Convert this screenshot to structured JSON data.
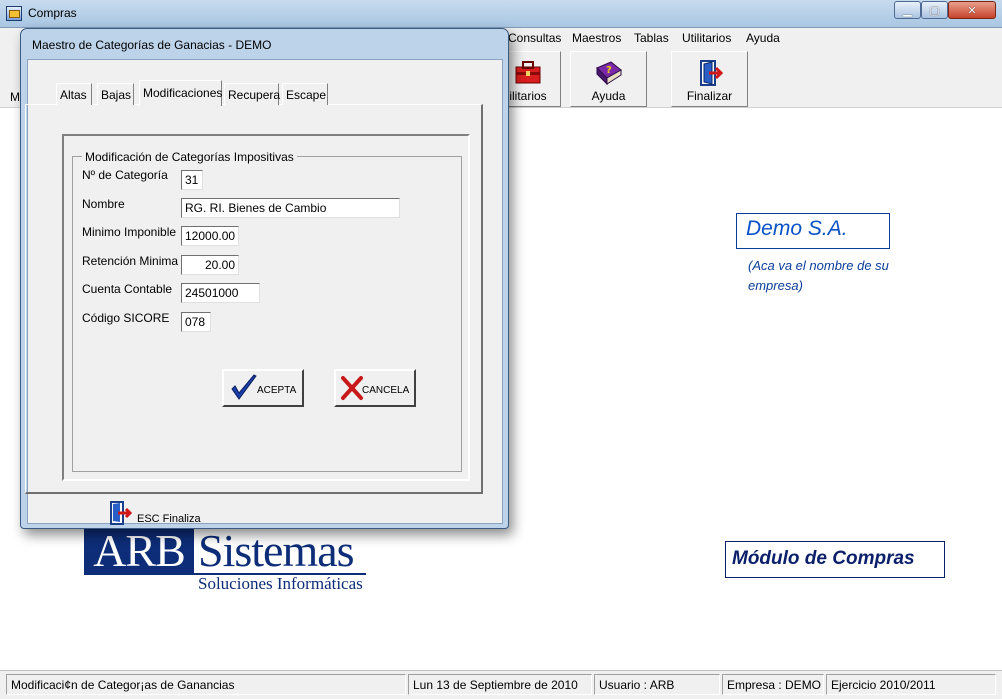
{
  "window": {
    "title": "Compras"
  },
  "menu": {
    "items": [
      "Consultas",
      "Maestros",
      "Tablas",
      "Utilitarios",
      "Ayuda"
    ]
  },
  "toolbar": {
    "left_fragment": "M",
    "buttons": [
      {
        "label": "ilitarios",
        "icon": "toolbox-icon"
      },
      {
        "label": "Ayuda",
        "icon": "help-book-icon"
      },
      {
        "label": "Finalizar",
        "icon": "exit-door-icon"
      }
    ]
  },
  "desktop": {
    "company_name": "Demo S.A.",
    "company_hint": "(Aca va el nombre de su empresa)",
    "module_title": "Módulo de Compras",
    "logo": {
      "arb": "ARB",
      "sistemas": "Sistemas",
      "tagline": "Soluciones Informáticas"
    }
  },
  "dialog": {
    "title": "Maestro de Categorías de Ganacias  - DEMO",
    "tabs": [
      "Altas",
      "Bajas",
      "Modificaciones",
      "Recupera",
      "Escape"
    ],
    "active_tab": "Modificaciones",
    "group_title": "Modificación de Categorías Impositivas",
    "fields": {
      "categoria": {
        "label": "Nº de Categoría",
        "value": "31"
      },
      "nombre": {
        "label": "Nombre",
        "value": "RG. RI. Bienes de Cambio"
      },
      "minimo": {
        "label": "Minimo Imponible",
        "value": "12000.00"
      },
      "retencion": {
        "label": "Retención Minima",
        "value": "20.00"
      },
      "cuenta": {
        "label": "Cuenta Contable",
        "value": "24501000"
      },
      "sicore": {
        "label": "Código SICORE",
        "value": "078"
      }
    },
    "accept_label": "ACEPTA",
    "cancel_label": "CANCELA",
    "esc_label": "ESC Finaliza"
  },
  "status": {
    "description": "Modificaci¢n de Categor¡as de Ganancias",
    "date": "Lun 13 de Septiembre de 2010",
    "user": "Usuario : ARB",
    "company": "Empresa : DEMO",
    "period": "Ejercicio 2010/2011"
  },
  "colors": {
    "accent_blue": "#0b52c7",
    "brand_navy": "#0d2d78",
    "accept_check": "#1a3fa8",
    "cancel_x": "#c81818"
  }
}
